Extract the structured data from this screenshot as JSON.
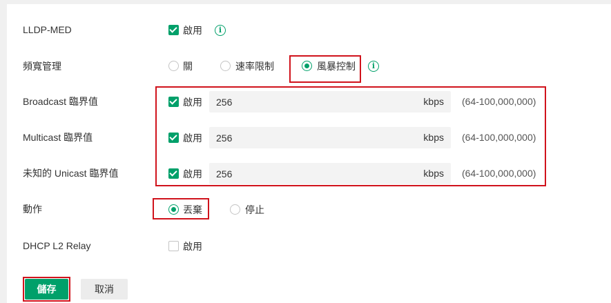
{
  "rows": {
    "lldp_med": {
      "label": "LLDP-MED",
      "enable_label": "啟用",
      "enabled": true
    },
    "bandwidth": {
      "label": "頻寬管理",
      "options": [
        "關",
        "速率限制",
        "風暴控制"
      ],
      "selected": "風暴控制"
    },
    "broadcast": {
      "label": "Broadcast 臨界值",
      "enable_label": "啟用",
      "enabled": true,
      "value": "256",
      "unit": "kbps",
      "range": "(64-100,000,000)"
    },
    "multicast": {
      "label": "Multicast 臨界值",
      "enable_label": "啟用",
      "enabled": true,
      "value": "256",
      "unit": "kbps",
      "range": "(64-100,000,000)"
    },
    "unknown_unicast": {
      "label": "未知的 Unicast 臨界值",
      "enable_label": "啟用",
      "enabled": true,
      "value": "256",
      "unit": "kbps",
      "range": "(64-100,000,000)"
    },
    "action": {
      "label": "動作",
      "options": [
        "丟棄",
        "停止"
      ],
      "selected": "丟棄"
    },
    "dhcp_l2_relay": {
      "label": "DHCP L2 Relay",
      "enable_label": "啟用",
      "enabled": false
    }
  },
  "buttons": {
    "save": "儲存",
    "cancel": "取消"
  },
  "info_icon_glyph": "i",
  "colors": {
    "accent": "#00a06a",
    "highlight": "#d0121b",
    "input_bg": "#f3f3f3"
  }
}
